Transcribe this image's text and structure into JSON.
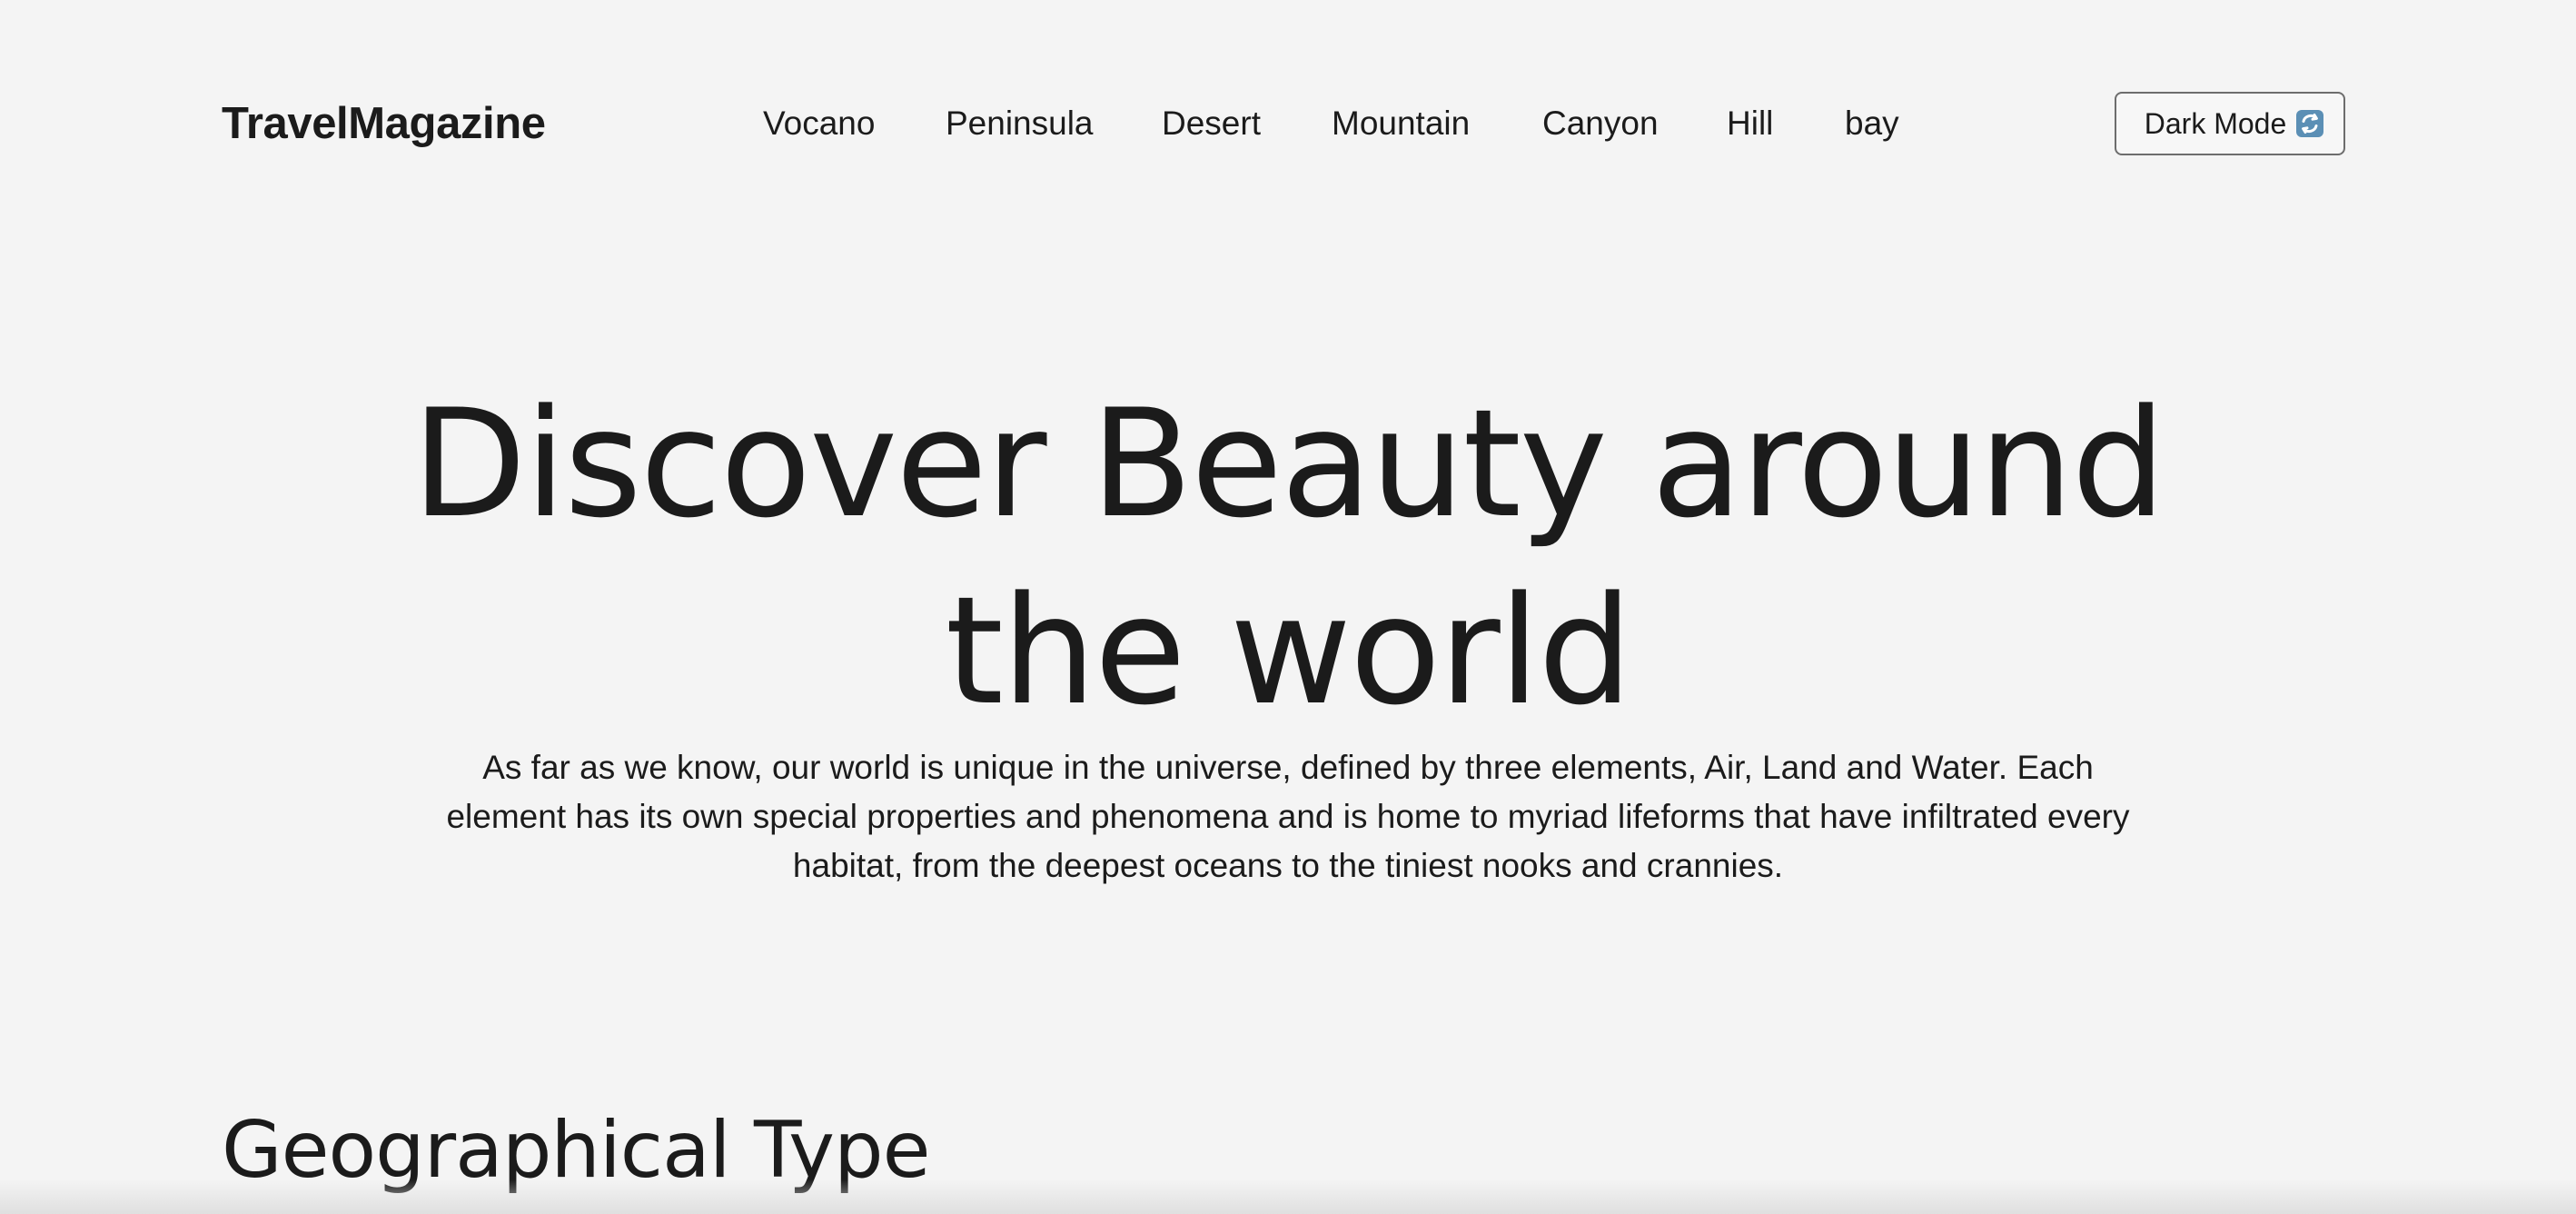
{
  "header": {
    "logo": "TravelMagazine",
    "nav_items": [
      {
        "label": "Vocano"
      },
      {
        "label": "Peninsula"
      },
      {
        "label": "Desert"
      },
      {
        "label": "Mountain"
      },
      {
        "label": "Canyon"
      },
      {
        "label": "Hill"
      },
      {
        "label": "bay"
      }
    ],
    "theme_button": {
      "label": "Dark Mode",
      "icon": "refresh-icon"
    }
  },
  "hero": {
    "title": "Discover Beauty around the world",
    "description": "As far as we know, our world is unique in the universe, defined by three elements, Air, Land and Water. Each element has its own special properties and phenomena and is home to myriad lifeforms that have infiltrated every habitat, from the deepest oceans to the tiniest nooks and crannies."
  },
  "sections": {
    "geographical_type": {
      "title": "Geographical Type"
    }
  },
  "colors": {
    "background": "#f4f4f4",
    "text": "#1b1b1b",
    "button_border": "#6d6d6d",
    "icon_blue": "#5b8fb5"
  }
}
